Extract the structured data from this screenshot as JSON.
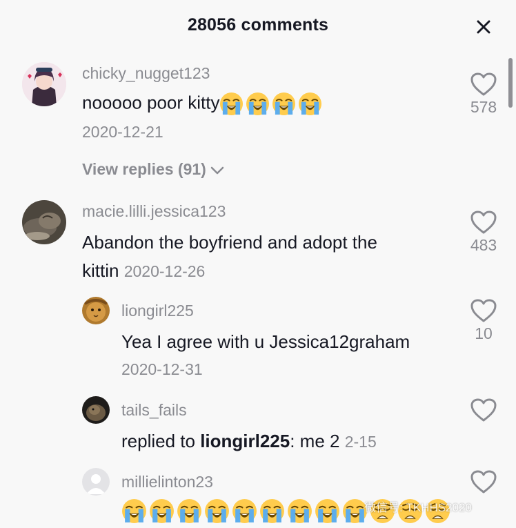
{
  "header": {
    "title": "28056 comments"
  },
  "colors": {
    "background": "#f8f8f8",
    "text": "#161823",
    "secondary": "#8a8b91"
  },
  "comments": [
    {
      "username": "chicky_nugget123",
      "text": "nooooo poor kitty",
      "emoji": [
        "loudly-crying-face",
        "loudly-crying-face",
        "loudly-crying-face",
        "loudly-crying-face"
      ],
      "date": "2020-12-21",
      "likes": "578",
      "view_replies": "View replies (91)"
    },
    {
      "username": "macie.lilli.jessica123",
      "text_line1": "Abandon the boyfriend and adopt the",
      "text_line2": "kittin",
      "date": "2020-12-26",
      "likes": "483"
    }
  ],
  "replies": [
    {
      "username": "liongirl225",
      "text": "Yea I agree with u Jessica12graham",
      "date": "2020-12-31",
      "likes": "10"
    },
    {
      "username": "tails_fails",
      "prefix": "replied to ",
      "mention": "liongirl225",
      "suffix": ": me 2",
      "date": "2-15"
    },
    {
      "username": "millielinton23",
      "emoji": [
        "loudly-crying-face",
        "loudly-crying-face",
        "loudly-crying-face",
        "loudly-crying-face",
        "loudly-crying-face",
        "loudly-crying-face",
        "loudly-crying-face",
        "loudly-crying-face",
        "loudly-crying-face",
        "weary-face",
        "weary-face",
        "weary-face"
      ]
    }
  ],
  "watermark": "微信号: TKHHS2020"
}
